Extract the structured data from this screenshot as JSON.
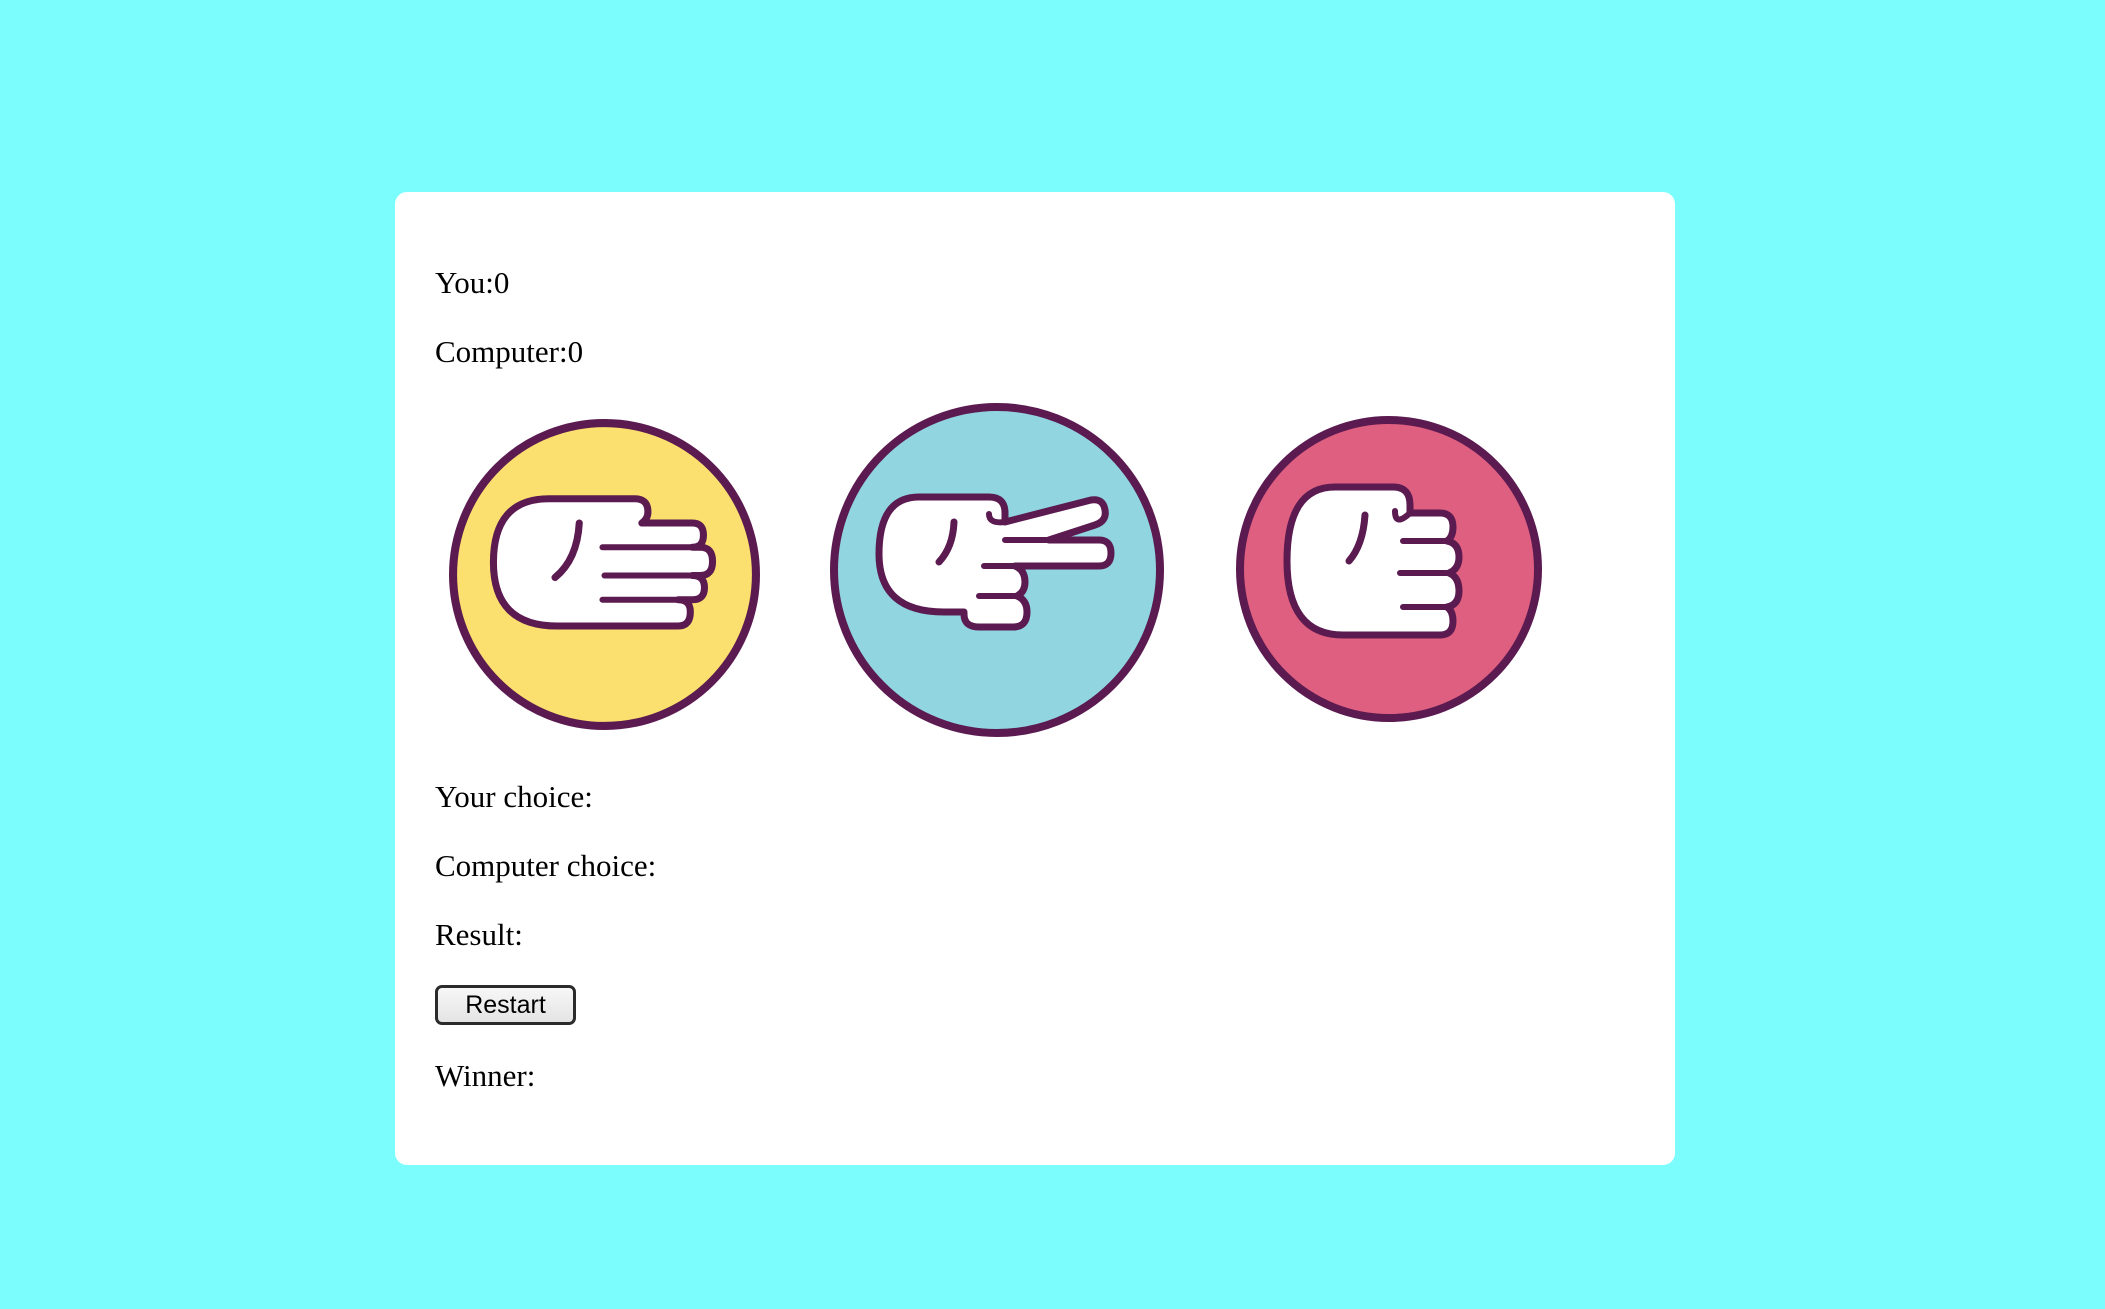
{
  "score": {
    "you_label": "You:",
    "you_value": "0",
    "computer_label": "Computer:",
    "computer_value": "0"
  },
  "choices": [
    {
      "name": "paper",
      "color": "#fbe06f"
    },
    {
      "name": "scissors",
      "color": "#91d5e0"
    },
    {
      "name": "rock",
      "color": "#de5f80"
    }
  ],
  "outline_color": "#5b1a50",
  "page_background": "#7afdfc",
  "status": {
    "your_choice_label": "Your choice:",
    "your_choice_value": "",
    "computer_choice_label": "Computer choice:",
    "computer_choice_value": "",
    "result_label": "Result:",
    "result_value": "",
    "winner_label": "Winner:",
    "winner_value": ""
  },
  "restart_label": "Restart"
}
